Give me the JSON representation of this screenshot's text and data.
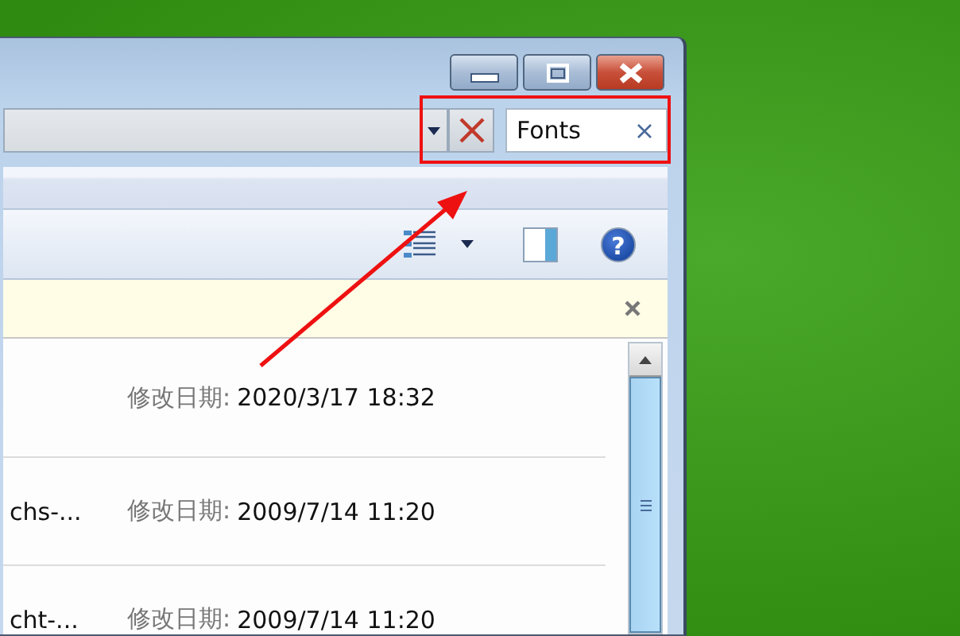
{
  "window": {
    "title_buttons": [
      {
        "kind": "minimize"
      },
      {
        "kind": "maximize"
      },
      {
        "kind": "close"
      }
    ]
  },
  "search": {
    "value": "Fonts"
  },
  "files": [
    {
      "date_label": "修改日期:",
      "date": "2020/3/17 18:32"
    },
    {
      "name": "chs-...",
      "date_label": "修改日期:",
      "date": "2009/7/14 11:20"
    },
    {
      "name": "cht-...",
      "date_label": "修改日期:",
      "date": "2009/7/14 11:20"
    }
  ],
  "help_button": {
    "glyph": "?"
  },
  "annotations": {
    "highlight_box": true,
    "arrow": true
  }
}
